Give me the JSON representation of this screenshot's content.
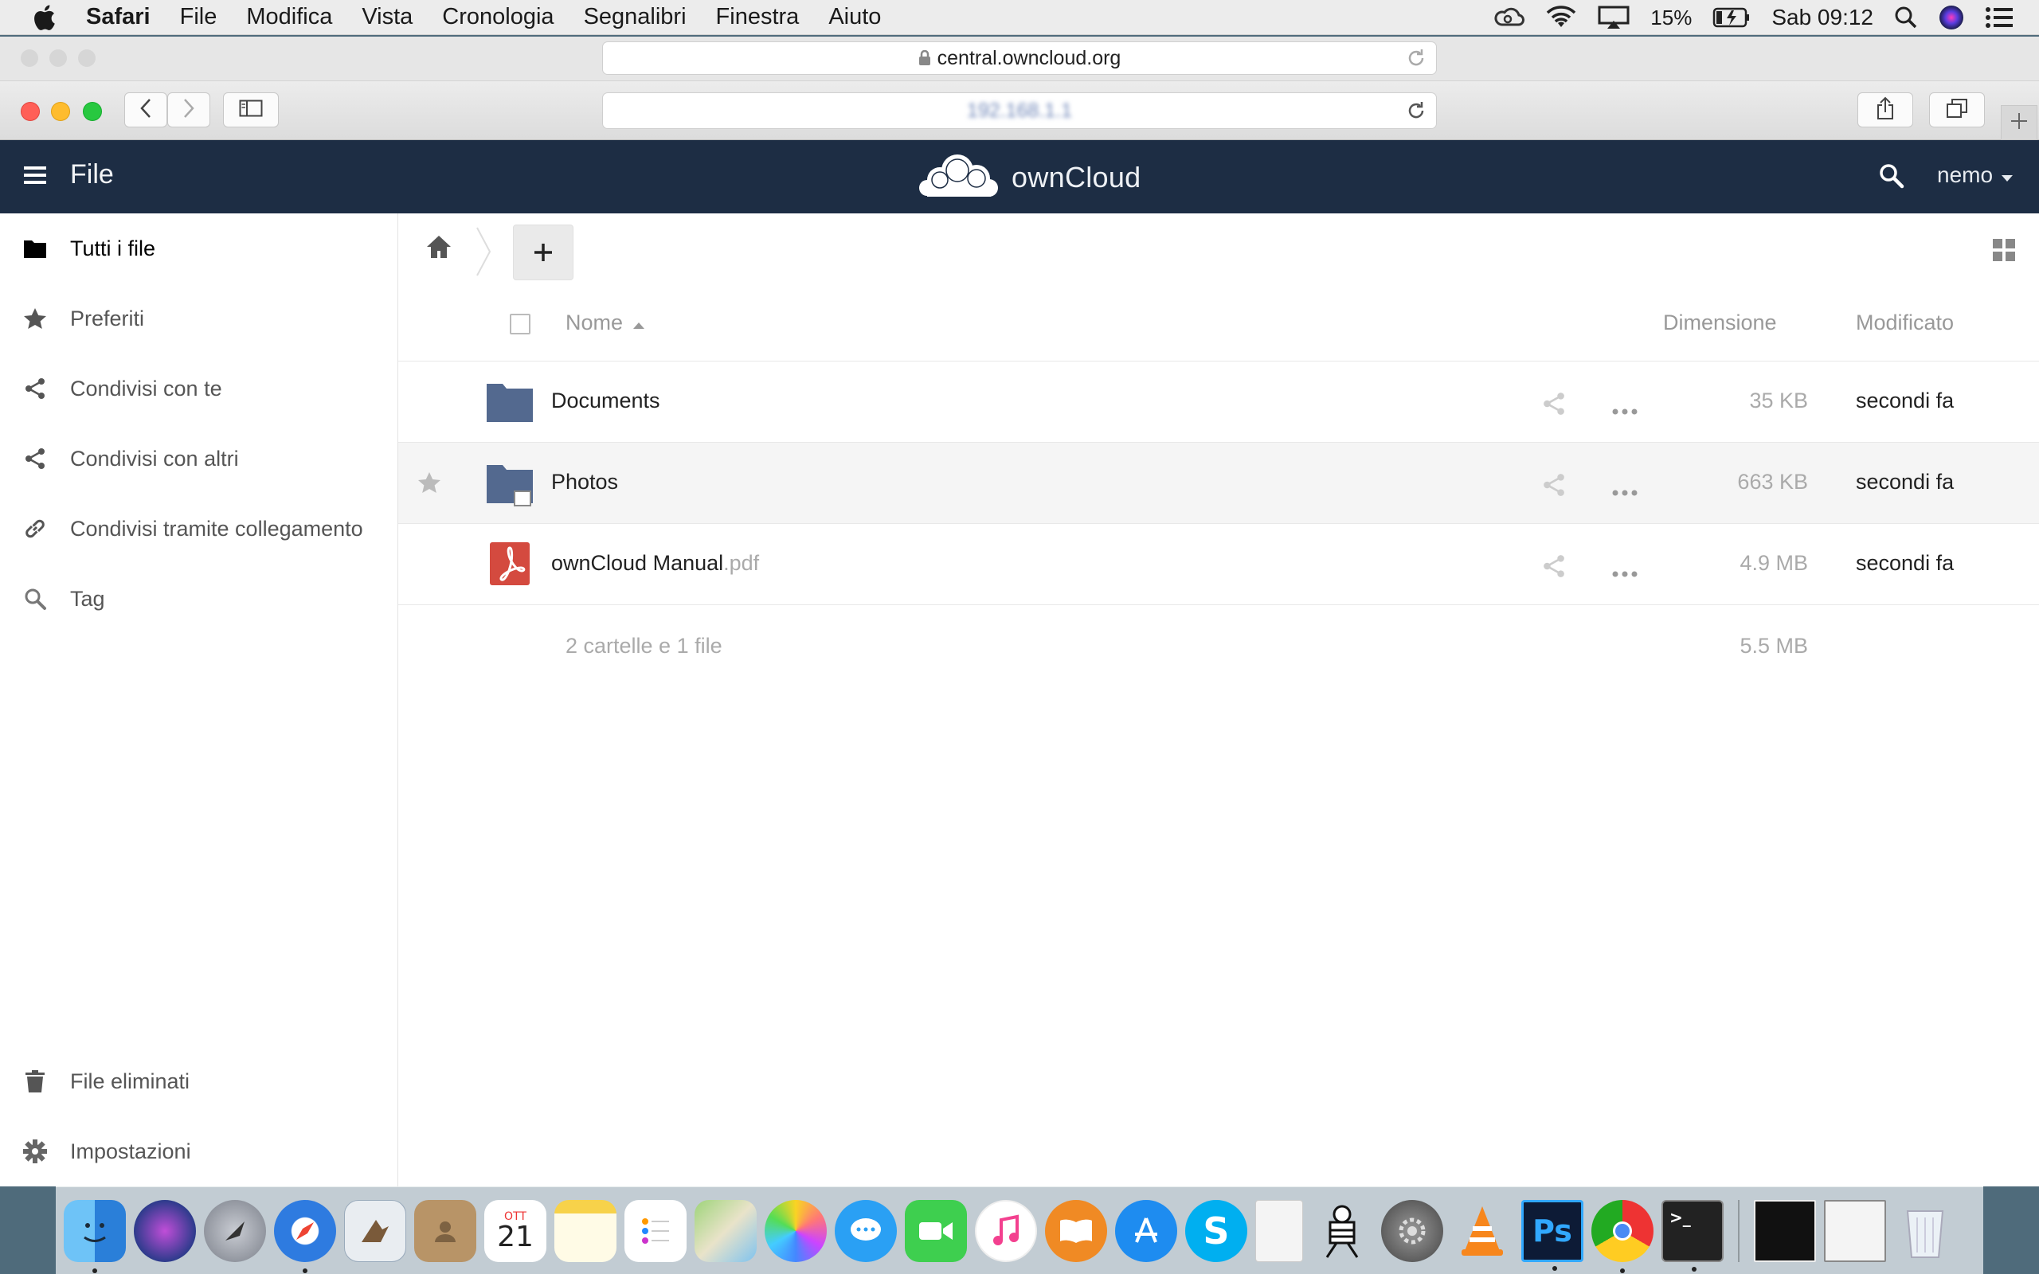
{
  "menubar": {
    "app_name": "Safari",
    "items": [
      "File",
      "Modifica",
      "Vista",
      "Cronologia",
      "Segnalibri",
      "Finestra",
      "Aiuto"
    ],
    "battery": "15%",
    "clock": "Sab 09:12"
  },
  "browser": {
    "background_url": "central.owncloud.org",
    "current_url": "192.168.1.1"
  },
  "header": {
    "app_title": "File",
    "brand": "ownCloud",
    "user": "nemo"
  },
  "sidebar": {
    "items": [
      {
        "label": "Tutti i file",
        "icon": "folder-icon"
      },
      {
        "label": "Preferiti",
        "icon": "star-icon"
      },
      {
        "label": "Condivisi con te",
        "icon": "share-icon"
      },
      {
        "label": "Condivisi con altri",
        "icon": "share-icon"
      },
      {
        "label": "Condivisi tramite collegamento",
        "icon": "link-icon"
      },
      {
        "label": "Tag",
        "icon": "search-icon"
      }
    ],
    "bottom": [
      {
        "label": "File eliminati",
        "icon": "trash-icon"
      },
      {
        "label": "Impostazioni",
        "icon": "gear-icon"
      }
    ]
  },
  "table": {
    "columns": {
      "name": "Nome",
      "size": "Dimensione",
      "modified": "Modificato"
    },
    "rows": [
      {
        "name": "Documents",
        "ext": "",
        "type": "folder",
        "size": "35 KB",
        "modified": "secondi fa"
      },
      {
        "name": "Photos",
        "ext": "",
        "type": "folder",
        "size": "663 KB",
        "modified": "secondi fa"
      },
      {
        "name": "ownCloud Manual",
        "ext": ".pdf",
        "type": "pdf",
        "size": "4.9 MB",
        "modified": "secondi fa"
      }
    ],
    "summary": {
      "info": "2 cartelle e 1 file",
      "total": "5.5 MB"
    }
  },
  "colors": {
    "header_bg": "#1d2d44",
    "folder": "#53698f",
    "pdf": "#d44a3f"
  },
  "dock": {
    "apps": [
      "Finder",
      "Siri",
      "Launchpad",
      "Safari",
      "Mail",
      "Contatti",
      "Calendario",
      "Note",
      "Promemoria",
      "Mappe",
      "Foto",
      "Messaggi",
      "FaceTime",
      "iTunes",
      "iBooks",
      "App Store",
      "Skype",
      "Documento",
      "Terminale Keyboard",
      "Preferenze di Sistema",
      "VLC",
      "Photoshop",
      "Chrome",
      "Terminale",
      "Documento scansionato",
      "Screenshot",
      "Cestino"
    ],
    "calendar_month": "OTT",
    "calendar_day": "21"
  }
}
